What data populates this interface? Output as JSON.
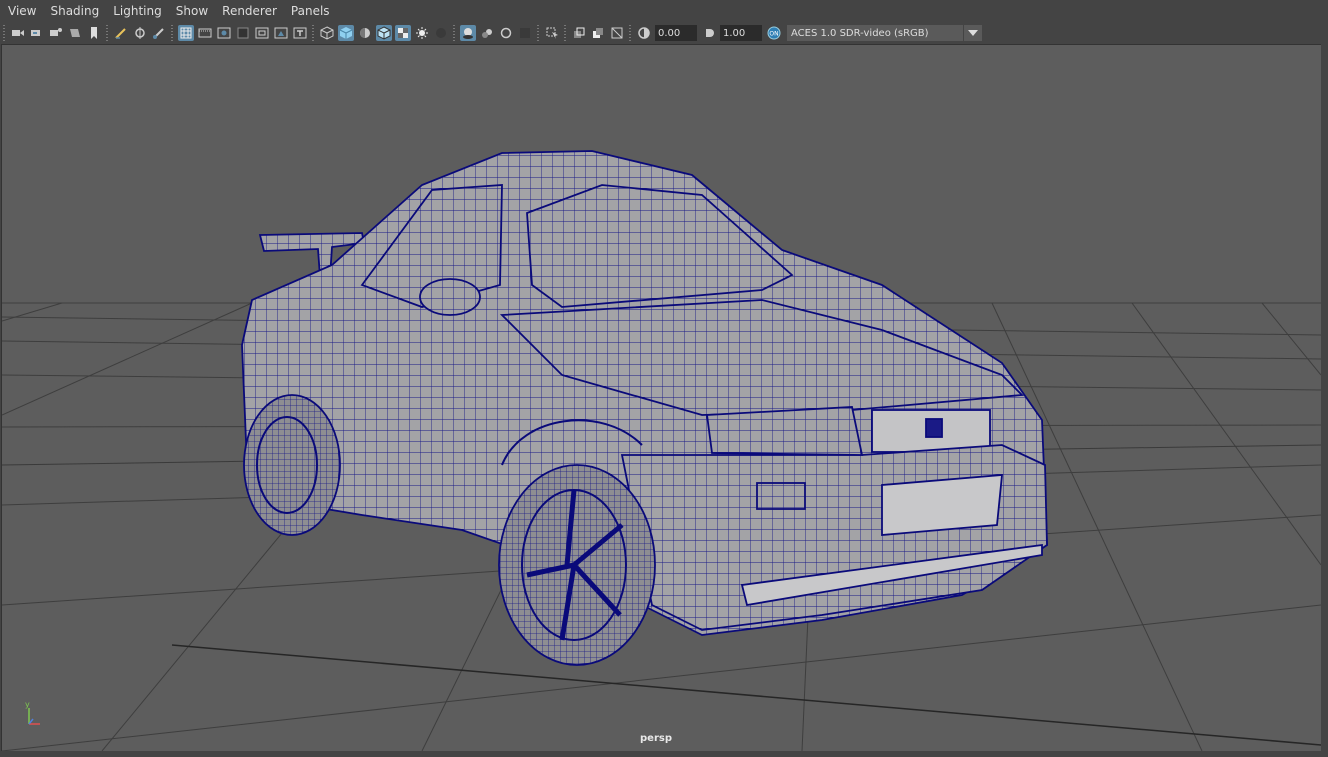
{
  "menubar": {
    "items": [
      "View",
      "Shading",
      "Lighting",
      "Show",
      "Renderer",
      "Panels"
    ]
  },
  "toolbar": {
    "exposure_value": "0.00",
    "gamma_value": "1.00",
    "color_space": "ACES 1.0 SDR-video (sRGB)",
    "icons": [
      "select-camera-icon",
      "camera-attributes-icon",
      "bookmarks-icon",
      "image-plane-icon",
      "bookmark-icon",
      "grease-pencil-icon",
      "2d-pan-zoom-icon",
      "grease-pencil-brush-icon",
      "grid-icon",
      "film-gate-icon",
      "resolution-gate-icon",
      "gate-mask-icon",
      "field-chart-icon",
      "safe-action-icon",
      "safe-title-icon",
      "wireframe-icon",
      "smooth-shade-icon",
      "default-material-icon",
      "wireframe-on-shaded-icon",
      "textured-icon",
      "use-all-lights-icon",
      "shadows-icon",
      "screen-space-ao-icon",
      "motion-blur-icon",
      "anti-aliasing-icon",
      "depth-of-field-icon",
      "isolate-select-icon",
      "xray-icon",
      "xray-joints-icon",
      "xray-components-icon",
      "exposure-icon",
      "gamma-icon",
      "color-management-icon"
    ]
  },
  "viewport": {
    "camera": "persp",
    "background": "#5d5d5d",
    "wire_color": "#000080"
  },
  "axis": {
    "y_label": "y"
  }
}
